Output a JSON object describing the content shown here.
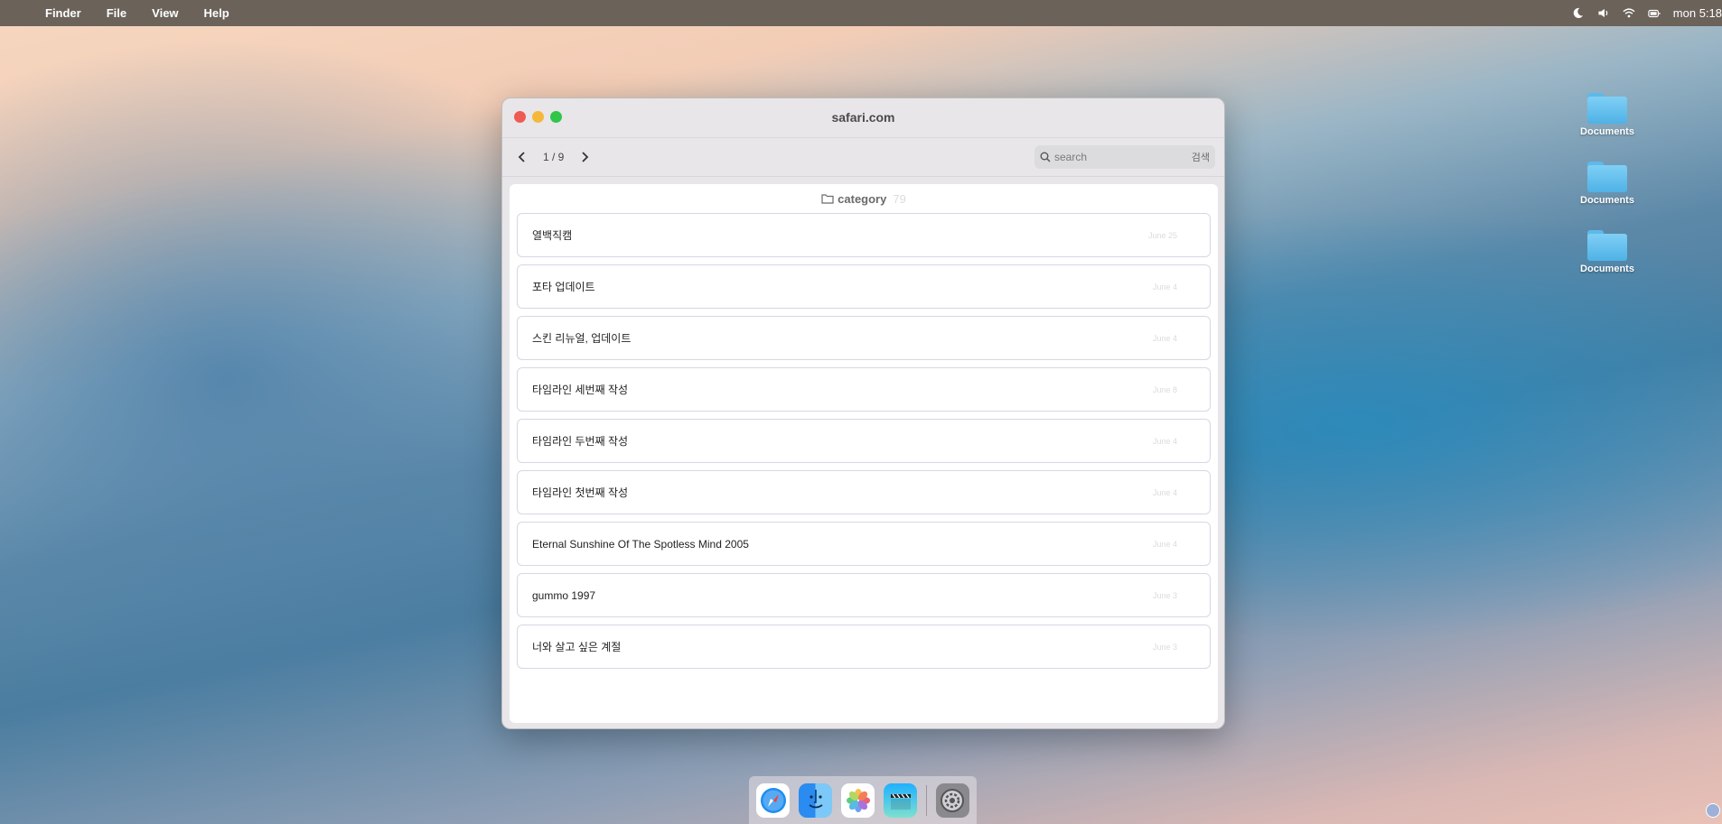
{
  "menubar": {
    "apple_glyph": "",
    "items": [
      "Finder",
      "File",
      "View",
      "Help"
    ],
    "clock": "mon 5:18"
  },
  "desktop": {
    "icons": [
      {
        "label": "Documents"
      },
      {
        "label": "Documents"
      },
      {
        "label": "Documents"
      }
    ]
  },
  "window": {
    "title": "safari.com",
    "page_indicator": "1 / 9",
    "search": {
      "placeholder": "search",
      "button": "검색"
    },
    "category": {
      "label": "category",
      "count": "79"
    },
    "posts": [
      {
        "title": "열백직캠",
        "date": "June 25"
      },
      {
        "title": "포타 업데이트",
        "date": "June 4"
      },
      {
        "title": "스킨 리뉴얼, 업데이트",
        "date": "June 4"
      },
      {
        "title": "타임라인 세번째 작성",
        "date": "June 8"
      },
      {
        "title": "타임라인 두번째 작성",
        "date": "June 4"
      },
      {
        "title": "타임라인 첫번째 작성",
        "date": "June 4"
      },
      {
        "title": "Eternal Sunshine Of The Spotless Mind 2005",
        "date": "June 4"
      },
      {
        "title": "gummo 1997",
        "date": "June 3"
      },
      {
        "title": "너와 살고 싶은 계절",
        "date": "June 3"
      }
    ]
  },
  "dock": {
    "apps": [
      "safari-icon",
      "finder-icon",
      "photos-icon",
      "imovie-icon",
      "settings-icon"
    ]
  },
  "colors": {
    "close": "#ee5b53",
    "minimize": "#f5b83a",
    "maximize": "#31c54a",
    "menubar": "#6b625a"
  }
}
